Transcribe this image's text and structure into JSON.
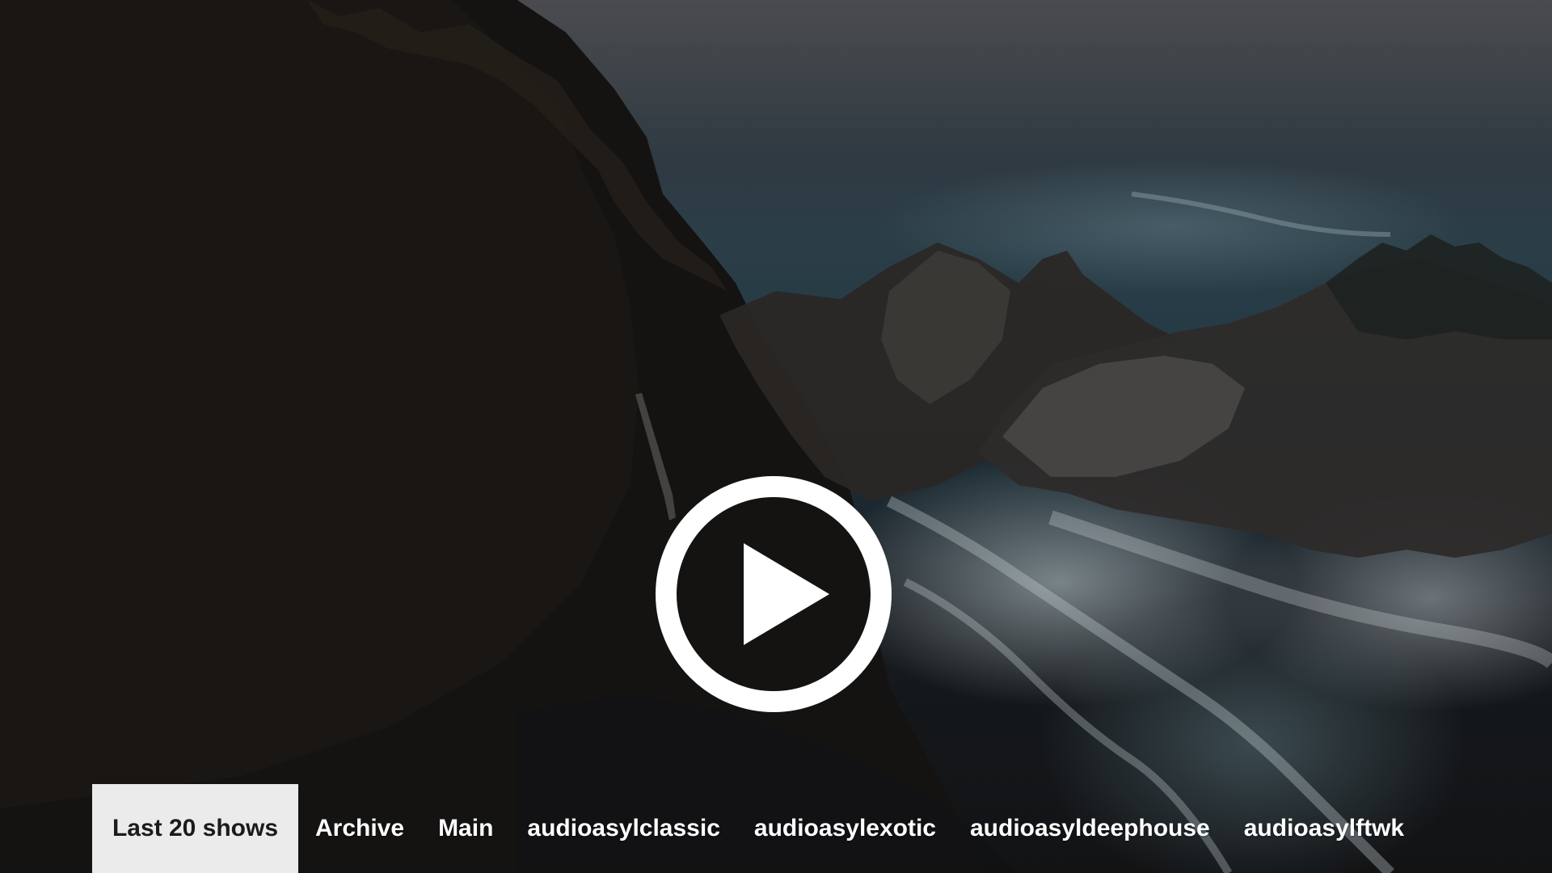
{
  "player": {
    "play_label": "Play",
    "icon": "play-circle-icon"
  },
  "tabs": [
    {
      "label": "Last 20 shows",
      "active": true
    },
    {
      "label": "Archive",
      "active": false
    },
    {
      "label": "Main",
      "active": false
    },
    {
      "label": "audioasylclassic",
      "active": false
    },
    {
      "label": "audioasylexotic",
      "active": false
    },
    {
      "label": "audioasyldeephouse",
      "active": false
    },
    {
      "label": "audioasylftwk",
      "active": false
    }
  ],
  "colors": {
    "active_tab_background": "#ebebeb",
    "active_tab_text": "#1b1b1b",
    "tab_text": "#ffffff",
    "play_icon": "#ffffff"
  }
}
